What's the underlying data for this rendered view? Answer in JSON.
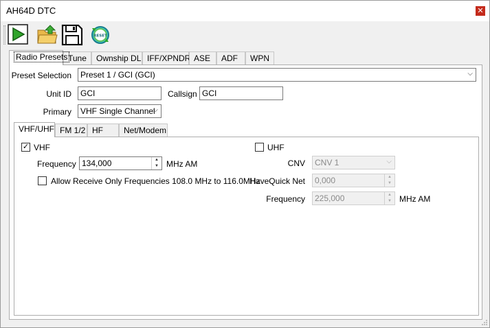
{
  "window": {
    "title": "AH64D DTC",
    "close_glyph": "✕"
  },
  "toolbar": {
    "buttons": [
      {
        "name": "run-icon"
      },
      {
        "name": "open-folder-icon"
      },
      {
        "name": "save-icon"
      },
      {
        "name": "reset-icon",
        "label": "RESET"
      }
    ]
  },
  "main_tabs": [
    "Radio Presets",
    "Tune",
    "Ownship DL",
    "IFF/XPNDR",
    "ASE",
    "ADF",
    "WPN"
  ],
  "preset": {
    "selection_label": "Preset Selection",
    "selection_value": "Preset 1 / GCI (GCI)",
    "unit_id_label": "Unit ID",
    "unit_id_value": "GCI",
    "callsign_label": "Callsign",
    "callsign_value": "GCI",
    "primary_label": "Primary",
    "primary_value": "VHF Single Channel"
  },
  "sub_tabs": [
    "VHF/UHF",
    "FM 1/2",
    "HF",
    "Net/Modem"
  ],
  "vhf": {
    "checkbox_label": "VHF",
    "checked_glyph": "✓",
    "frequency_label": "Frequency",
    "frequency_value": "134,000",
    "unit": "MHz AM",
    "allow_label": "Allow Receive Only Frequencies 108.0 MHz to 116.0MHz"
  },
  "uhf": {
    "checkbox_label": "UHF",
    "cnv_label": "CNV",
    "cnv_value": "CNV 1",
    "havequick_label": "HaveQuick Net",
    "havequick_value": "0,000",
    "frequency_label": "Frequency",
    "frequency_value": "225,000",
    "unit": "MHz AM"
  }
}
